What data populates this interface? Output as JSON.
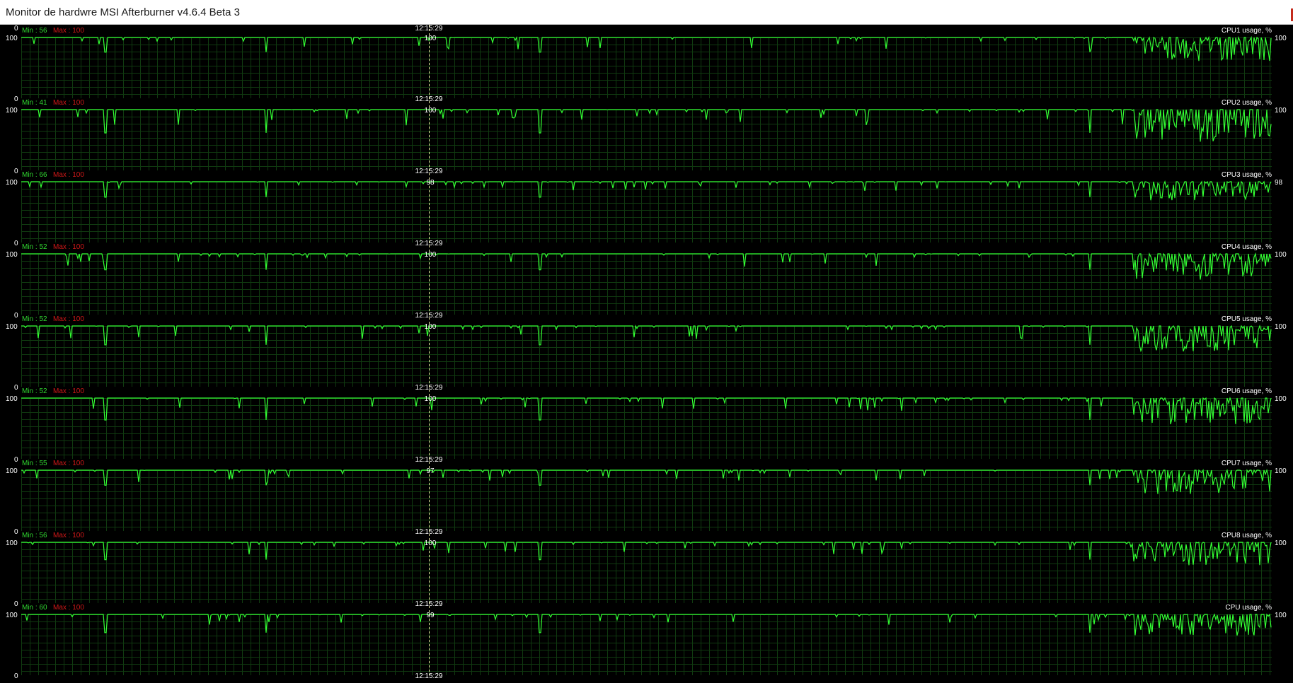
{
  "window": {
    "title": "Monitor de hardwre MSI Afterburner v4.6.4 Beta 3"
  },
  "colors": {
    "background": "#000000",
    "grid": "#103a10",
    "trace": "#33ff33",
    "min_label": "#30d630",
    "max_label": "#d01818",
    "cursor": "#e8e8a0",
    "text": "#ffffff"
  },
  "cursor_time": "12:15:29",
  "graphs": [
    {
      "name": "CPU1 usage, %",
      "min_label": "Min : 56",
      "max_label": "Max : 100",
      "axis_top": "100",
      "axis_bottom": "0",
      "cursor_value": "100",
      "current_value": "100",
      "min": 56,
      "max": 100
    },
    {
      "name": "CPU2 usage, %",
      "min_label": "Min : 41",
      "max_label": "Max : 100",
      "axis_top": "100",
      "axis_bottom": "0",
      "cursor_value": "100",
      "current_value": "100",
      "min": 41,
      "max": 100
    },
    {
      "name": "CPU3 usage, %",
      "min_label": "Min : 66",
      "max_label": "Max : 100",
      "axis_top": "100",
      "axis_bottom": "0",
      "cursor_value": "98",
      "current_value": "98",
      "min": 66,
      "max": 100
    },
    {
      "name": "CPU4 usage, %",
      "min_label": "Min : 52",
      "max_label": "Max : 100",
      "axis_top": "100",
      "axis_bottom": "0",
      "cursor_value": "100",
      "current_value": "100",
      "min": 52,
      "max": 100
    },
    {
      "name": "CPU5 usage, %",
      "min_label": "Min : 52",
      "max_label": "Max : 100",
      "axis_top": "100",
      "axis_bottom": "0",
      "cursor_value": "100",
      "current_value": "100",
      "min": 52,
      "max": 100
    },
    {
      "name": "CPU6 usage, %",
      "min_label": "Min : 52",
      "max_label": "Max : 100",
      "axis_top": "100",
      "axis_bottom": "0",
      "cursor_value": "100",
      "current_value": "100",
      "min": 52,
      "max": 100
    },
    {
      "name": "CPU7 usage, %",
      "min_label": "Min : 55",
      "max_label": "Max : 100",
      "axis_top": "100",
      "axis_bottom": "0",
      "cursor_value": "97",
      "current_value": "100",
      "min": 55,
      "max": 100
    },
    {
      "name": "CPU8 usage, %",
      "min_label": "Min : 56",
      "max_label": "Max : 100",
      "axis_top": "100",
      "axis_bottom": "0",
      "cursor_value": "100",
      "current_value": "100",
      "min": 56,
      "max": 100
    },
    {
      "name": "CPU usage, %",
      "min_label": "Min : 60",
      "max_label": "Max : 100",
      "axis_top": "100",
      "axis_bottom": "0",
      "cursor_value": "99",
      "current_value": "100",
      "min": 60,
      "max": 100
    }
  ]
}
